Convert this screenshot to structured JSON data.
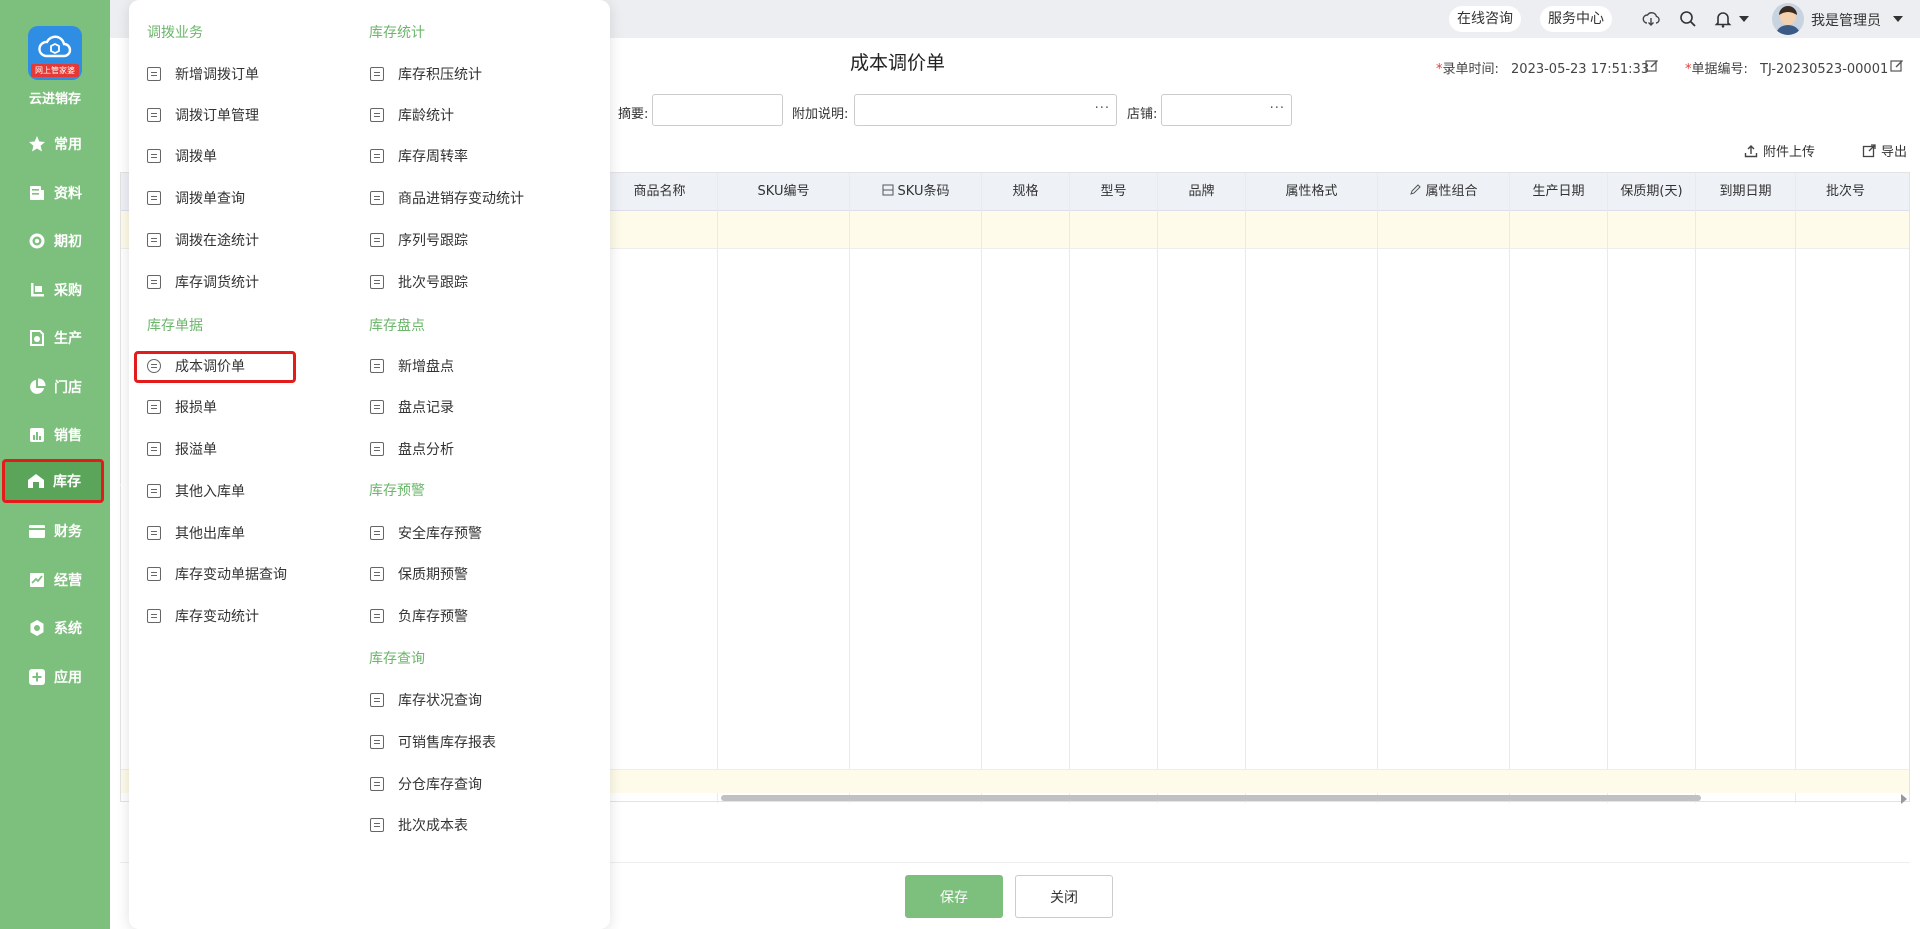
{
  "sidebar": {
    "logo_badge": "网上管家婆",
    "brand": "云进销存",
    "items": [
      {
        "label": "常用",
        "icon": "star-icon"
      },
      {
        "label": "资料",
        "icon": "document-icon"
      },
      {
        "label": "期初",
        "icon": "target-icon"
      },
      {
        "label": "采购",
        "icon": "cart-icon"
      },
      {
        "label": "生产",
        "icon": "production-icon"
      },
      {
        "label": "门店",
        "icon": "pie-icon"
      },
      {
        "label": "销售",
        "icon": "chart-icon"
      },
      {
        "label": "库存",
        "icon": "warehouse-icon"
      },
      {
        "label": "财务",
        "icon": "wallet-icon"
      },
      {
        "label": "经营",
        "icon": "trend-icon"
      },
      {
        "label": "系统",
        "icon": "gear-icon"
      },
      {
        "label": "应用",
        "icon": "plus-square-icon"
      }
    ]
  },
  "topbar": {
    "online_consult": "在线咨询",
    "service_center": "服务中心",
    "username": "我是管理员"
  },
  "page": {
    "title": "成本调价单",
    "entry_time_label": "录单时间:",
    "entry_time": "2023-05-23 17:51:33",
    "doc_no_label": "单据编号:",
    "doc_no": "TJ-20230523-00001",
    "summary_label": "摘要:",
    "note_label": "附加说明:",
    "store_label": "店铺:",
    "attach_upload": "附件上传",
    "export": "导出",
    "save": "保存",
    "close": "关闭"
  },
  "table": {
    "columns": [
      "商品名称",
      "SKU编号",
      "SKU条码",
      "规格",
      "型号",
      "品牌",
      "属性格式",
      "属性组合",
      "生产日期",
      "保质期(天)",
      "到期日期",
      "批次号"
    ]
  },
  "menu": {
    "col1": [
      {
        "title": "调拨业务",
        "items": [
          "新增调拨订单",
          "调拨订单管理",
          "调拨单",
          "调拨单查询",
          "调拨在途统计",
          "库存调货统计"
        ]
      },
      {
        "title": "库存单据",
        "items": [
          "成本调价单",
          "报损单",
          "报溢单",
          "其他入库单",
          "其他出库单",
          "库存变动单据查询",
          "库存变动统计"
        ]
      }
    ],
    "col2": [
      {
        "title": "库存统计",
        "items": [
          "库存积压统计",
          "库龄统计",
          "库存周转率",
          "商品进销存变动统计",
          "序列号跟踪",
          "批次号跟踪"
        ]
      },
      {
        "title": "库存盘点",
        "items": [
          "新增盘点",
          "盘点记录",
          "盘点分析"
        ]
      },
      {
        "title": "库存预警",
        "items": [
          "安全库存预警",
          "保质期预警",
          "负库存预警"
        ]
      },
      {
        "title": "库存查询",
        "items": [
          "库存状况查询",
          "可销售库存报表",
          "分仓库存查询",
          "批次成本表"
        ]
      }
    ]
  }
}
